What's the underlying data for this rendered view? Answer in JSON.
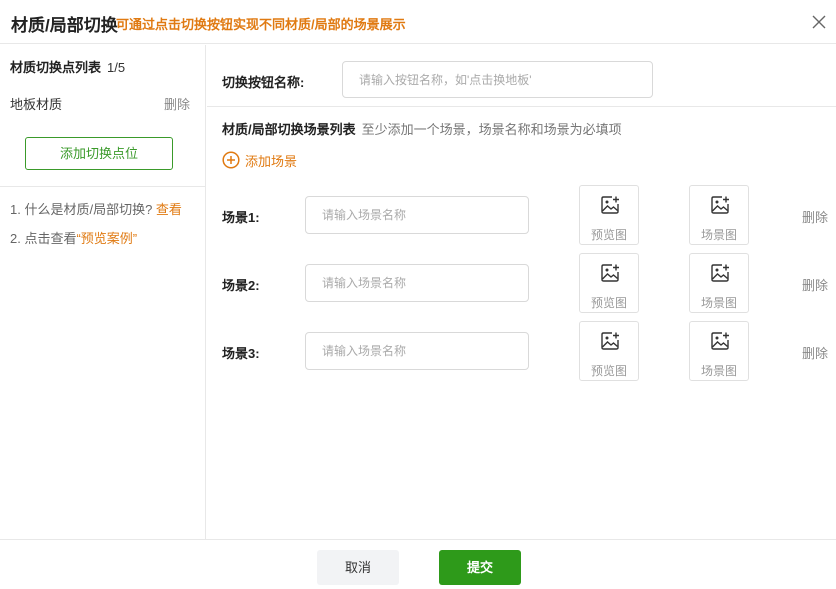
{
  "header": {
    "title": "材质/局部切换",
    "subtitle": "可通过点击切换按钮实现不同材质/局部的场景展示"
  },
  "left": {
    "list_label": "材质切换点列表",
    "list_count": "1/5",
    "items": [
      {
        "name": "地板材质",
        "delete": "删除"
      }
    ],
    "add_button": "添加切换点位",
    "help": {
      "line1_text": "1. 什么是材质/局部切换?",
      "line1_link": "查看",
      "line2_text": "2. 点击查看",
      "line2_link": "“预览案例”"
    }
  },
  "right": {
    "name_label": "切换按钮名称:",
    "name_placeholder": "请输入按钮名称，如'点击换地板'",
    "scene_list_label": "材质/局部切换场景列表",
    "scene_list_hint": "至少添加一个场景，场景名称和场景为必填项",
    "add_scene": "添加场景",
    "scenes": [
      {
        "label": "场景1:",
        "placeholder": "请输入场景名称",
        "preview": "预览图",
        "scene": "场景图",
        "delete": "删除"
      },
      {
        "label": "场景2:",
        "placeholder": "请输入场景名称",
        "preview": "预览图",
        "scene": "场景图",
        "delete": "删除"
      },
      {
        "label": "场景3:",
        "placeholder": "请输入场景名称",
        "preview": "预览图",
        "scene": "场景图",
        "delete": "删除"
      }
    ]
  },
  "footer": {
    "cancel": "取消",
    "submit": "提交"
  },
  "colors": {
    "accent_orange": "#e07a12",
    "primary_green": "#2e9a1a"
  },
  "icons": {
    "close": "close-icon",
    "add_scene": "plus-circle-icon",
    "upload": "image-add-icon"
  }
}
